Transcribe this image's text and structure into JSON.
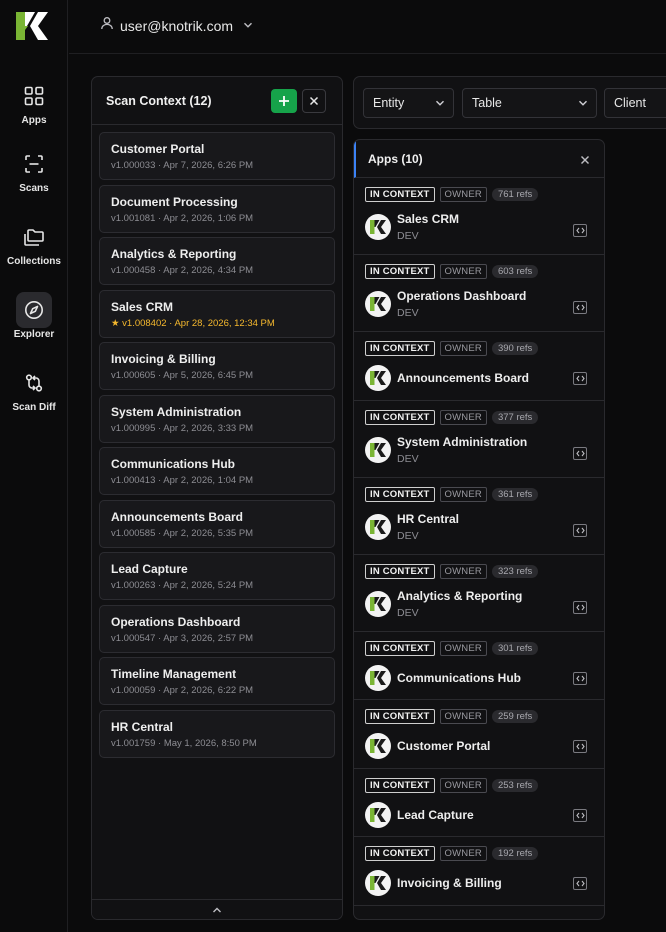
{
  "nav": {
    "items": [
      {
        "label": "Apps",
        "icon": "grid-icon"
      },
      {
        "label": "Scans",
        "icon": "scan-icon"
      },
      {
        "label": "Collections",
        "icon": "folders-icon"
      },
      {
        "label": "Explorer",
        "icon": "compass-icon"
      },
      {
        "label": "Scan Diff",
        "icon": "diff-icon"
      }
    ],
    "active": "Explorer"
  },
  "header": {
    "user_email": "user@knotrik.com"
  },
  "scan_context": {
    "title": "Scan Context (12)",
    "scans": [
      {
        "name": "Customer Portal",
        "meta": "v1.000033 · Apr 7, 2026, 6:26 PM"
      },
      {
        "name": "Document Processing",
        "meta": "v1.001081 · Apr 2, 2026, 1:06 PM"
      },
      {
        "name": "Analytics & Reporting",
        "meta": "v1.000458 · Apr 2, 2026, 4:34 PM"
      },
      {
        "name": "Sales CRM",
        "meta": "★ v1.008402 · Apr 28, 2026, 12:34 PM",
        "starred": true
      },
      {
        "name": "Invoicing & Billing",
        "meta": "v1.000605 · Apr 5, 2026, 6:45 PM"
      },
      {
        "name": "System Administration",
        "meta": "v1.000995 · Apr 2, 2026, 3:33 PM"
      },
      {
        "name": "Communications Hub",
        "meta": "v1.000413 · Apr 2, 2026, 1:04 PM"
      },
      {
        "name": "Announcements Board",
        "meta": "v1.000585 · Apr 2, 2026, 5:35 PM"
      },
      {
        "name": "Lead Capture",
        "meta": "v1.000263 · Apr 2, 2026, 5:24 PM"
      },
      {
        "name": "Operations Dashboard",
        "meta": "v1.000547 · Apr 3, 2026, 2:57 PM"
      },
      {
        "name": "Timeline Management",
        "meta": "v1.000059 · Apr 2, 2026, 6:22 PM"
      },
      {
        "name": "HR Central",
        "meta": "v1.001759 · May 1, 2026, 8:50 PM"
      }
    ]
  },
  "filters": {
    "entity": "Entity",
    "table": "Table",
    "client": "Client"
  },
  "apps_panel": {
    "title": "Apps (10)",
    "tag_context": "IN CONTEXT",
    "tag_owner": "OWNER",
    "apps": [
      {
        "name": "Sales CRM",
        "refs": "761 refs",
        "env": "DEV"
      },
      {
        "name": "Operations Dashboard",
        "refs": "603 refs",
        "env": "DEV"
      },
      {
        "name": "Announcements Board",
        "refs": "390 refs",
        "env": ""
      },
      {
        "name": "System Administration",
        "refs": "377 refs",
        "env": "DEV"
      },
      {
        "name": "HR Central",
        "refs": "361 refs",
        "env": "DEV"
      },
      {
        "name": "Analytics & Reporting",
        "refs": "323 refs",
        "env": "DEV"
      },
      {
        "name": "Communications Hub",
        "refs": "301 refs",
        "env": ""
      },
      {
        "name": "Customer Portal",
        "refs": "259 refs",
        "env": ""
      },
      {
        "name": "Lead Capture",
        "refs": "253 refs",
        "env": ""
      },
      {
        "name": "Invoicing & Billing",
        "refs": "192 refs",
        "env": ""
      }
    ]
  },
  "colors": {
    "brand_green": "#7ab534",
    "add_button": "#16a34a",
    "star": "#f5b82e",
    "accent_blue": "#3b82f6"
  }
}
